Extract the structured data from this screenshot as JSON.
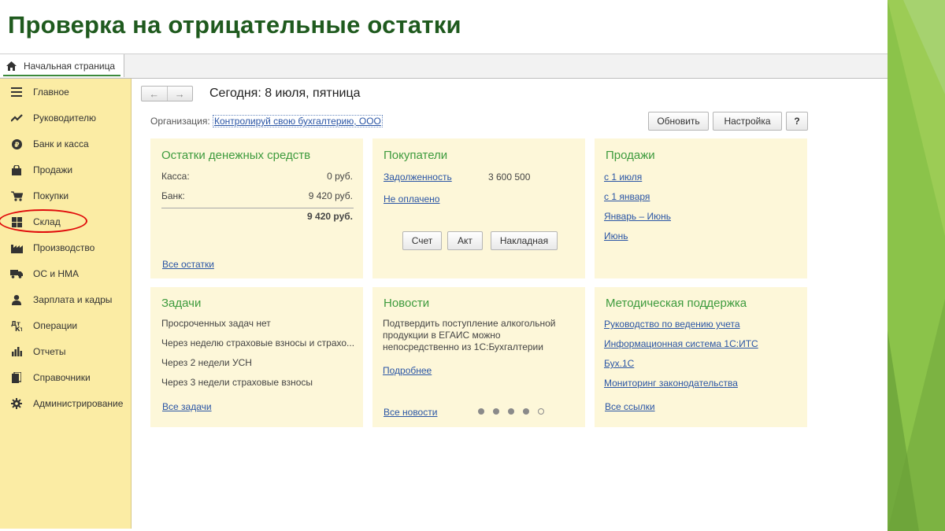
{
  "slide": {
    "title": "Проверка на отрицательные остатки"
  },
  "tabs": {
    "home": "Начальная страница"
  },
  "sidebar": {
    "items": [
      {
        "label": "Главное",
        "icon": "menu-lines-icon"
      },
      {
        "label": "Руководителю",
        "icon": "trend-line-icon"
      },
      {
        "label": "Банк и касса",
        "icon": "ruble-coin-icon"
      },
      {
        "label": "Продажи",
        "icon": "shopping-bag-icon"
      },
      {
        "label": "Покупки",
        "icon": "shopping-cart-icon"
      },
      {
        "label": "Склад",
        "icon": "warehouse-grid-icon"
      },
      {
        "label": "Производство",
        "icon": "factory-icon"
      },
      {
        "label": "ОС и НМА",
        "icon": "truck-icon"
      },
      {
        "label": "Зарплата и кадры",
        "icon": "person-icon"
      },
      {
        "label": "Операции",
        "icon": "operations-icon"
      },
      {
        "label": "Отчеты",
        "icon": "bar-chart-icon"
      },
      {
        "label": "Справочники",
        "icon": "books-icon"
      },
      {
        "label": "Администрирование",
        "icon": "gear-icon"
      }
    ],
    "highlighted": "Склад"
  },
  "header": {
    "today": "Сегодня: 8 июля, пятница",
    "org_label": "Организация:",
    "org_value": "Контролируй свою бухгалтерию, ООО",
    "refresh": "Обновить",
    "settings": "Настройка",
    "help": "?"
  },
  "cards": {
    "cash": {
      "title": "Остатки денежных средств",
      "kassa_label": "Касса:",
      "kassa_value": "0 руб.",
      "bank_label": "Банк:",
      "bank_value": "9 420 руб.",
      "total": "9 420 руб.",
      "link": "Все остатки"
    },
    "buyers": {
      "title": "Покупатели",
      "debt_label": "Задолженность",
      "debt_value": "3 600 500",
      "unpaid": "Не оплачено",
      "btn_invoice": "Счет",
      "btn_act": "Акт",
      "btn_waybill": "Накладная"
    },
    "sales": {
      "title": "Продажи",
      "links": [
        "с 1 июля",
        "с 1 января",
        "Январь – Июнь",
        "Июнь"
      ]
    },
    "tasks": {
      "title": "Задачи",
      "items": [
        "Просроченных задач нет",
        "Через неделю страховые взносы и страхо...",
        "Через 2 недели УСН",
        "Через 3 недели страховые взносы"
      ],
      "link": "Все задачи"
    },
    "news": {
      "title": "Новости",
      "text1": "Подтвердить поступление алкогольной",
      "text2": "продукции в ЕГАИС можно",
      "text3": "непосредственно из 1С:Бухгалтерии",
      "more": "Подробнее",
      "all": "Все новости",
      "pager_total": 5,
      "pager_current": 5
    },
    "support": {
      "title": "Методическая поддержка",
      "links": [
        "Руководство по ведению учета",
        "Информационная система 1С:ИТС",
        "Бух.1С",
        "Мониторинг законодательства"
      ],
      "all": "Все ссылки"
    }
  },
  "colors": {
    "sidebar_bg": "#fbeca4",
    "card_bg": "#fdf7d9",
    "title_green": "#1f5a1e",
    "card_title_green": "#3e9b3e",
    "link_blue": "#2a55a5",
    "highlight_red": "#e00b0b",
    "deco_green": "#8bc34a"
  }
}
